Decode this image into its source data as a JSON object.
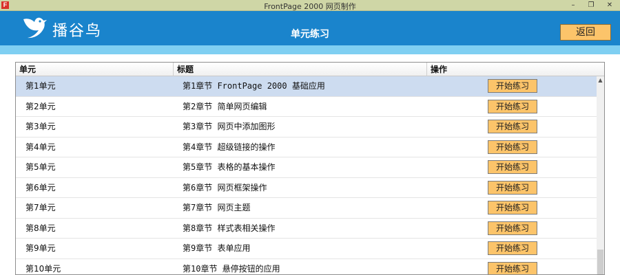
{
  "window": {
    "title": "FrontPage 2000 网页制作",
    "app_icon_letter": "F",
    "min_glyph": "–",
    "max_glyph": "❐",
    "close_glyph": "✕"
  },
  "header": {
    "brand": "播谷鸟",
    "title": "单元练习",
    "back_label": "返回",
    "colors": {
      "header_bg": "#1a84cc",
      "subbar": "#7fcff2",
      "button_bg": "#fcc46a"
    }
  },
  "table": {
    "columns": [
      "单元",
      "标题",
      "操作"
    ],
    "selected_row": 0,
    "rows": [
      {
        "unit": "第1单元",
        "title": "第1章节 FrontPage 2000 基础应用",
        "action": "开始练习"
      },
      {
        "unit": "第2单元",
        "title": "第2章节 简单网页编辑",
        "action": "开始练习"
      },
      {
        "unit": "第3单元",
        "title": "第3章节 网页中添加图形",
        "action": "开始练习"
      },
      {
        "unit": "第4单元",
        "title": "第4章节 超级链接的操作",
        "action": "开始练习"
      },
      {
        "unit": "第5单元",
        "title": "第5章节 表格的基本操作",
        "action": "开始练习"
      },
      {
        "unit": "第6单元",
        "title": "第6章节 网页框架操作",
        "action": "开始练习"
      },
      {
        "unit": "第7单元",
        "title": "第7章节 网页主题",
        "action": "开始练习"
      },
      {
        "unit": "第8单元",
        "title": "第8章节 样式表相关操作",
        "action": "开始练习"
      },
      {
        "unit": "第9单元",
        "title": "第9章节 表单应用",
        "action": "开始练习"
      },
      {
        "unit": "第10单元",
        "title": "第10章节 悬停按钮的应用",
        "action": "开始练习"
      }
    ]
  },
  "icons": {
    "logo": "bird-logo-icon",
    "scroll_up": "scroll-up-arrow-icon"
  }
}
